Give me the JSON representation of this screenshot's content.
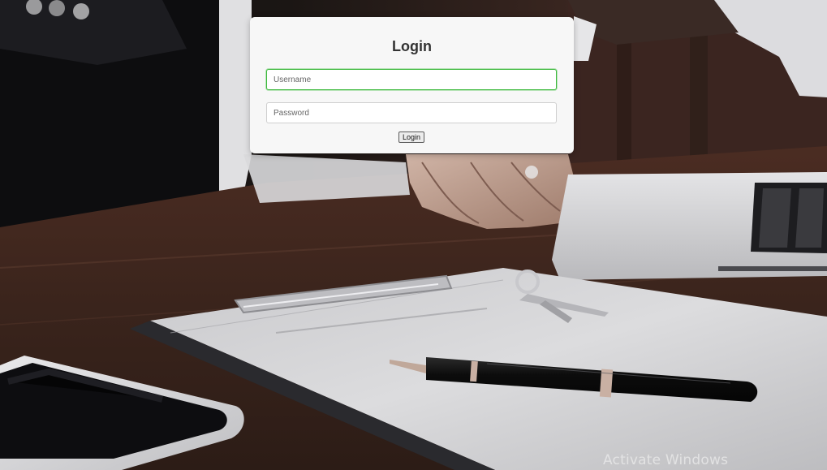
{
  "login": {
    "title": "Login",
    "username_placeholder": "Username",
    "username_value": "",
    "password_placeholder": "Password",
    "password_value": "",
    "submit_label": "Login"
  },
  "system": {
    "watermark": "Activate Windows"
  },
  "colors": {
    "card_background": "#f7f7f7",
    "focus_border": "#3cb93c",
    "title_text": "#333333"
  },
  "background": {
    "description_icon": "desk-scene-photo"
  }
}
